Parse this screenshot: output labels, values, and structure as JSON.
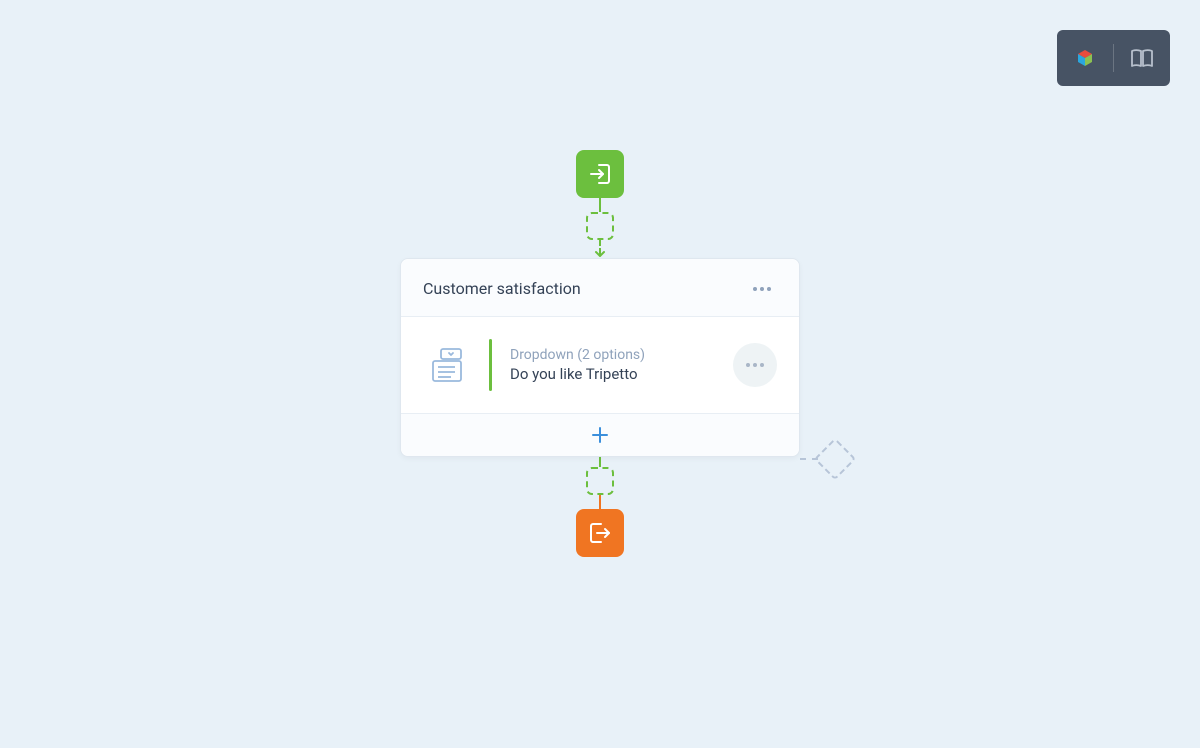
{
  "toolbar": {
    "logo_icon": "tripetto-logo",
    "docs_icon": "book-open"
  },
  "flow": {
    "start_icon": "enter-arrow",
    "end_icon": "exit-arrow",
    "card": {
      "title": "Customer satisfaction",
      "question": {
        "meta": "Dropdown (2 options)",
        "text": "Do you like Tripetto"
      },
      "add_icon": "plus"
    }
  }
}
